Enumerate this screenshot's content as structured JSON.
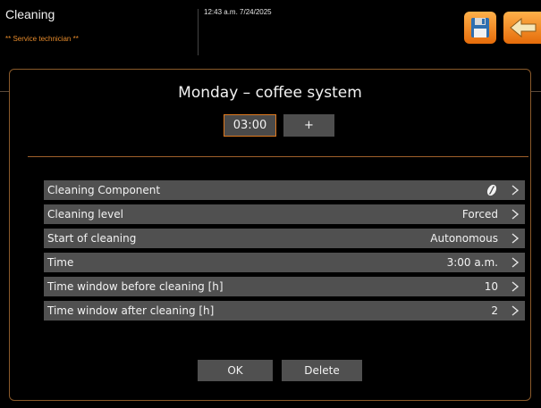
{
  "header": {
    "title": "Cleaning",
    "role": "** Service technician **",
    "datetime": "12:43 a.m. 7/24/2025",
    "save_icon": "floppy-disk-icon",
    "back_icon": "arrow-left-icon"
  },
  "dialog": {
    "title": "Monday – coffee system",
    "time_value": "03:00",
    "plus_label": "+",
    "rows": [
      {
        "label": "Cleaning Component",
        "value": "",
        "icon": "coffee-bean-icon"
      },
      {
        "label": "Cleaning level",
        "value": "Forced"
      },
      {
        "label": "Start of cleaning",
        "value": "Autonomous"
      },
      {
        "label": "Time",
        "value": "3:00 a.m."
      },
      {
        "label": "Time window before cleaning [h]",
        "value": "10"
      },
      {
        "label": "Time window after cleaning [h]",
        "value": "2"
      }
    ],
    "ok_label": "OK",
    "delete_label": "Delete"
  },
  "colors": {
    "accent": "#e07a1f",
    "row_bg": "#505050",
    "background": "#000000"
  }
}
